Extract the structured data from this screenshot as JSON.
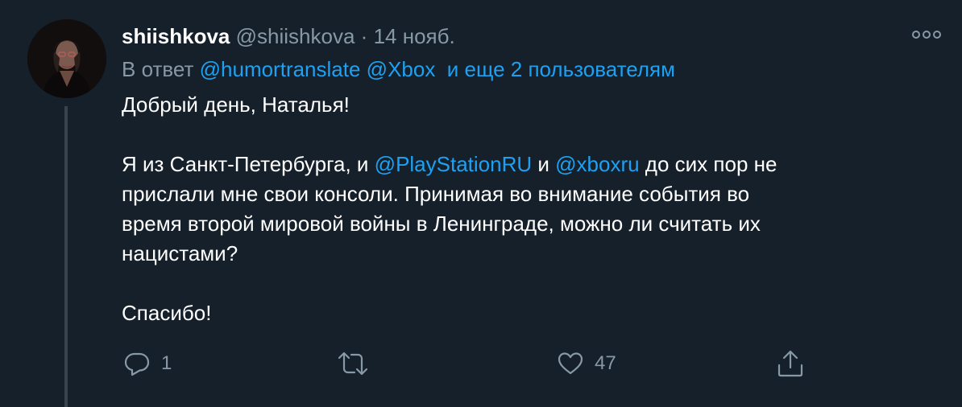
{
  "tweet": {
    "author_name": "shiishkova",
    "author_handle": "@shiishkova",
    "separator": "·",
    "date": "14 нояб.",
    "reply_prefix": "В ответ",
    "reply_mentions": [
      "@humortranslate",
      "@Xbox"
    ],
    "reply_others": "и еще 2 пользователям",
    "body": {
      "greeting": "Добрый день, Наталья!",
      "para_start": "Я из Санкт-Петербурга, и ",
      "mention_1": "@PlayStationRU",
      "para_mid": " и ",
      "mention_2": "@xboxru",
      "para_line1_end": " до сих пор не",
      "para_line2": "прислали мне свои консоли. Принимая во внимание события во",
      "para_line3": "время второй мировой войны в Ленинграде, можно ли считать их",
      "para_line4": "нацистами?",
      "thanks": "Спасибо!"
    },
    "actions": {
      "reply_icon": "reply-icon",
      "reply_count": "1",
      "retweet_icon": "retweet-icon",
      "like_icon": "heart-icon",
      "like_count": "47",
      "share_icon": "share-icon"
    },
    "more_icon": "more-icon"
  },
  "colors": {
    "background": "#15202b",
    "text": "#ffffff",
    "secondary": "#8899a6",
    "link": "#1da1f2",
    "thread_line": "#38444d"
  }
}
